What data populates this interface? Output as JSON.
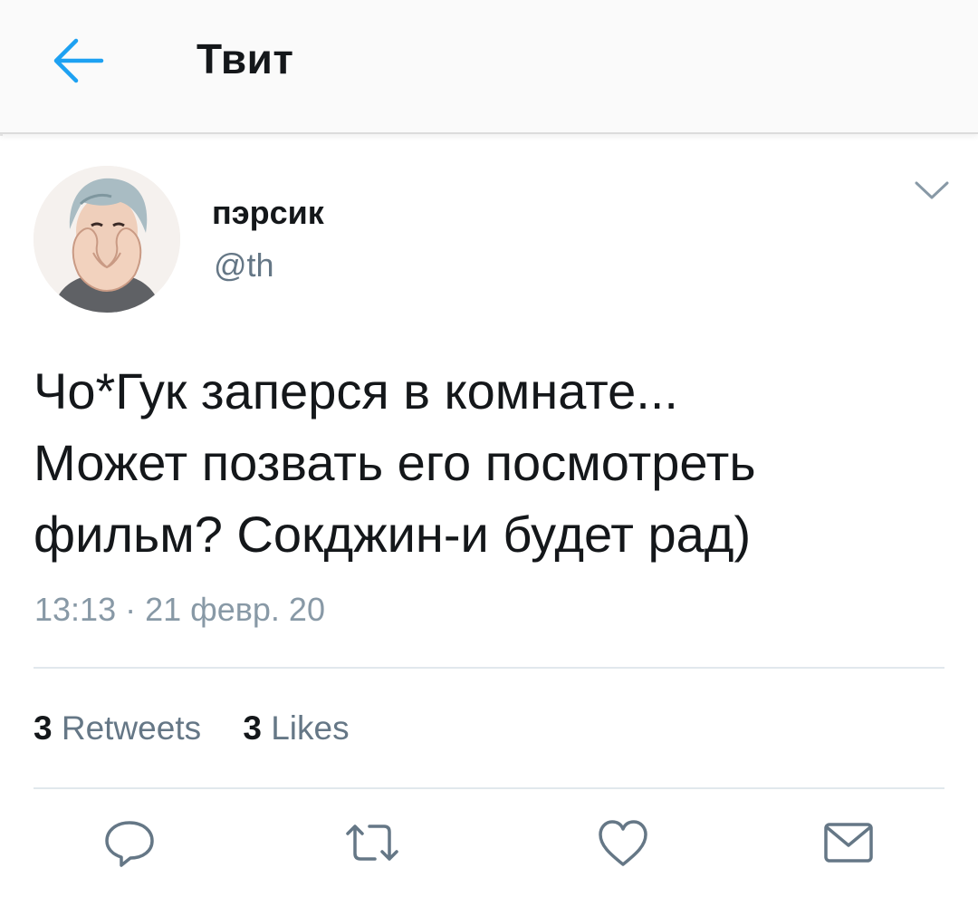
{
  "header": {
    "title": "Твит",
    "back_icon": "arrow-left-icon"
  },
  "tweet": {
    "display_name": "пэрсик",
    "handle": "@th",
    "text_lines": [
      "Чо*Гук заперся в комнате...",
      "Может позвать его посмотреть",
      "фильм? Сокджин-и будет рад)"
    ],
    "timestamp": "13:13 · 21 февр. 20",
    "stats": {
      "retweets_count": "3",
      "retweets_label": "Retweets",
      "likes_count": "3",
      "likes_label": "Likes"
    },
    "actions": [
      "reply-icon",
      "retweet-icon",
      "like-icon",
      "share-icon"
    ]
  },
  "colors": {
    "accent": "#1da1f2",
    "text_primary": "#14171a",
    "text_secondary": "#657786",
    "icon_gray": "#657786"
  }
}
